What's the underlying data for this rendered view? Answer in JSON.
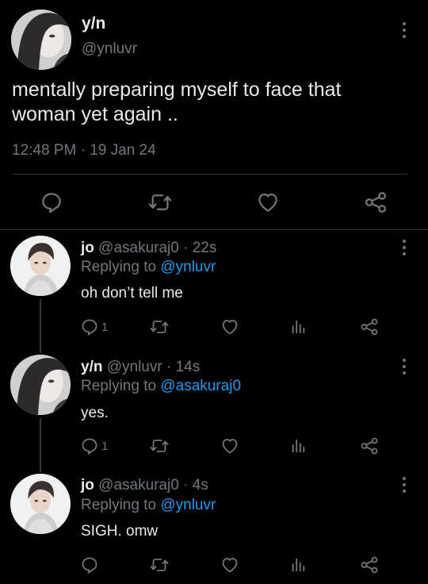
{
  "main_tweet": {
    "display_name": "y/n",
    "handle": "@ynluvr",
    "text_line1": "mentally preparing myself to face that",
    "text_line2": "woman yet again ..",
    "time": "12:48 PM",
    "date_sep": "·",
    "date": "19 Jan 24"
  },
  "replies": [
    {
      "display_name": "jo",
      "handle": "@asakuraj0",
      "age": "· 22s",
      "replying_prefix": "Replying to",
      "replying_to": "@ynluvr",
      "text": "oh don’t tell me",
      "reply_count": "1"
    },
    {
      "display_name": "y/n",
      "handle": "@ynluvr",
      "age": "· 14s",
      "replying_prefix": "Replying to",
      "replying_to": "@asakuraj0",
      "text": "yes.",
      "reply_count": "1"
    },
    {
      "display_name": "jo",
      "handle": "@asakuraj0",
      "age": "· 4s",
      "replying_prefix": "Replying to",
      "replying_to": "@ynluvr",
      "text": "SIGH. omw",
      "reply_count": ""
    }
  ],
  "icons": {
    "reply": "reply-bubble-icon",
    "retweet": "retweet-icon",
    "like": "heart-icon",
    "share": "share-icon",
    "analytics": "analytics-icon",
    "more": "more-vertical-icon"
  },
  "colors": {
    "background": "#000000",
    "text": "#e7e9ea",
    "secondary": "#71767b",
    "link": "#1d9bf0",
    "divider": "#2f3336"
  }
}
